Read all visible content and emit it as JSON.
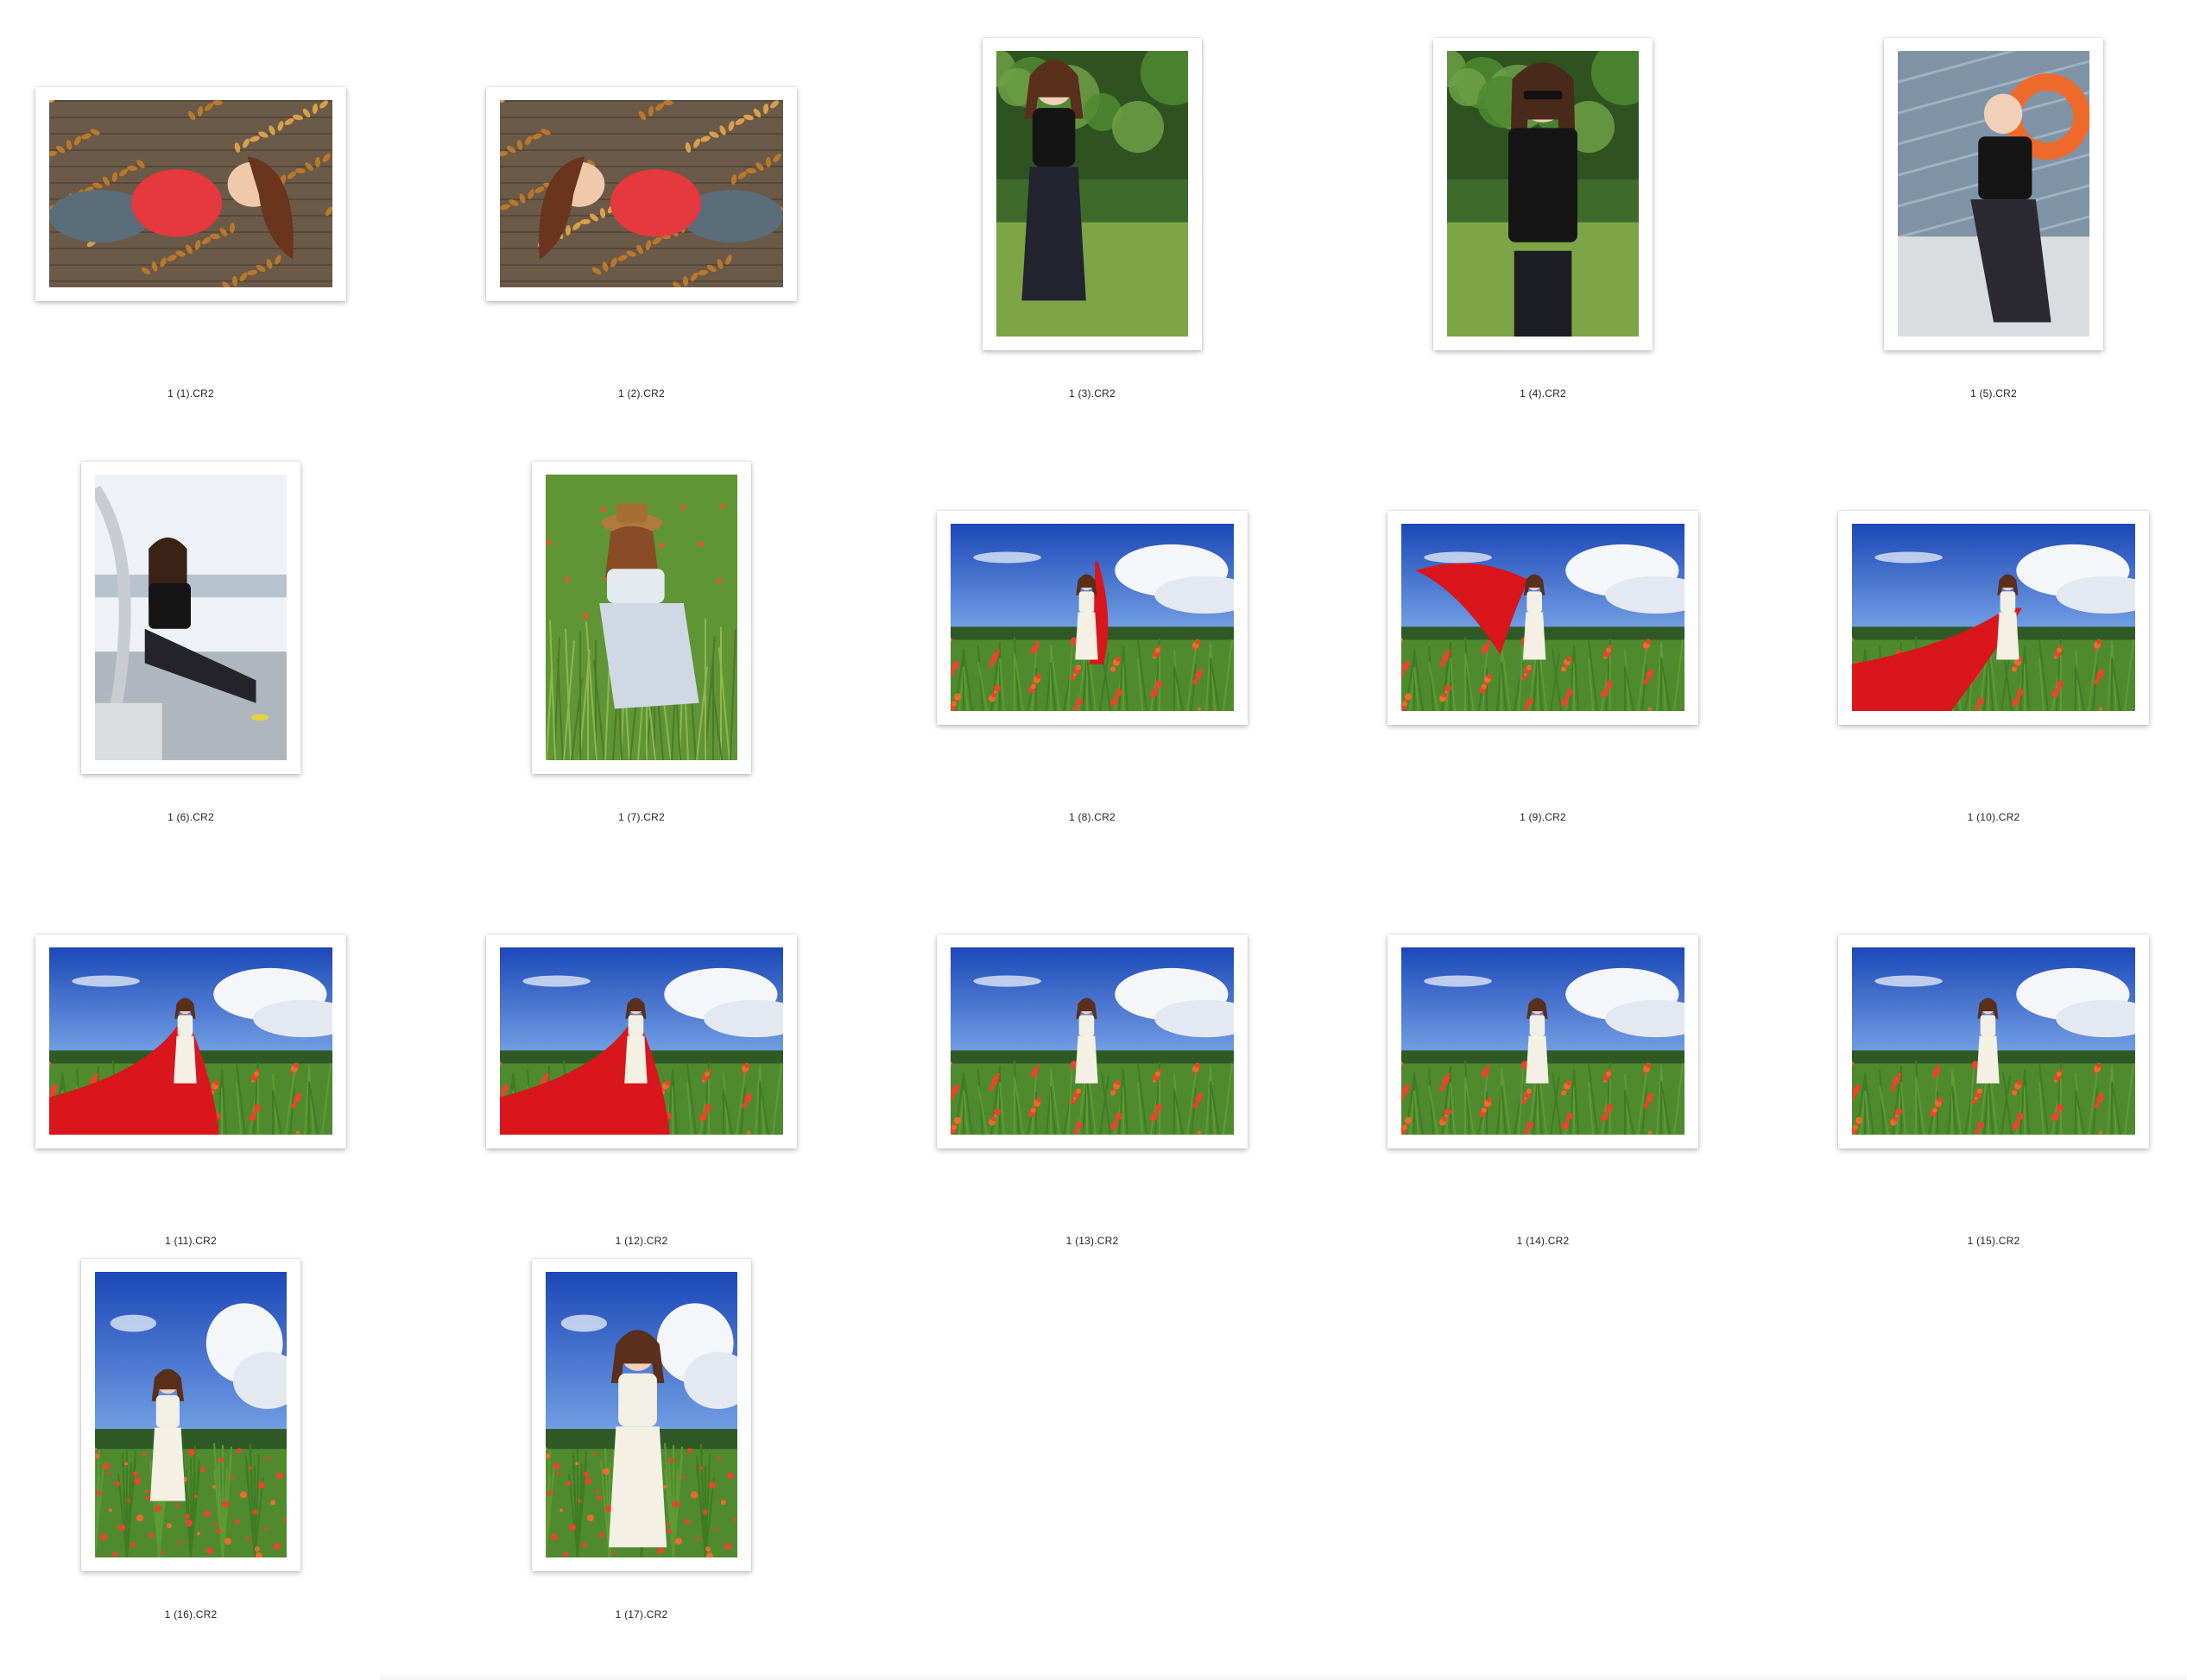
{
  "window": {
    "view": "icon-view"
  },
  "colors": {
    "background": "#ffffff",
    "label": "#222222",
    "frame": "#ffffff",
    "accent_red": "#d8161c",
    "sky_blue": "#1f56c9"
  },
  "items": [
    {
      "label": "1 (1).CR2",
      "orientation": "landscape",
      "scene": "leaves-lying"
    },
    {
      "label": "1 (2).CR2",
      "orientation": "landscape",
      "scene": "leaves-lying-closeup"
    },
    {
      "label": "1 (3).CR2",
      "orientation": "portrait",
      "scene": "park-standing"
    },
    {
      "label": "1 (4).CR2",
      "orientation": "portrait",
      "scene": "park-sunglasses"
    },
    {
      "label": "1 (5).CR2",
      "orientation": "portrait",
      "scene": "boat-lifebuoy"
    },
    {
      "label": "1 (6).CR2",
      "orientation": "portrait",
      "scene": "railing-seated"
    },
    {
      "label": "1 (7).CR2",
      "orientation": "portrait",
      "scene": "grass-hat-seated"
    },
    {
      "label": "1 (8).CR2",
      "orientation": "landscape",
      "scene": "field-red-scarf"
    },
    {
      "label": "1 (9).CR2",
      "orientation": "landscape",
      "scene": "field-red-scarf-wave"
    },
    {
      "label": "1 (10).CR2",
      "orientation": "landscape",
      "scene": "field-red-train"
    },
    {
      "label": "1 (11).CR2",
      "orientation": "landscape",
      "scene": "field-red-train-wide"
    },
    {
      "label": "1 (12).CR2",
      "orientation": "landscape",
      "scene": "field-red-train-back"
    },
    {
      "label": "1 (13).CR2",
      "orientation": "landscape",
      "scene": "flower-field-white-dress"
    },
    {
      "label": "1 (14).CR2",
      "orientation": "landscape",
      "scene": "flower-field-white-dress-far"
    },
    {
      "label": "1 (15).CR2",
      "orientation": "landscape",
      "scene": "flower-field-white-dress-pose"
    },
    {
      "label": "1 (16).CR2",
      "orientation": "portrait",
      "scene": "flower-field-arm-up"
    },
    {
      "label": "1 (17).CR2",
      "orientation": "portrait",
      "scene": "flower-field-wave-closeup"
    }
  ]
}
